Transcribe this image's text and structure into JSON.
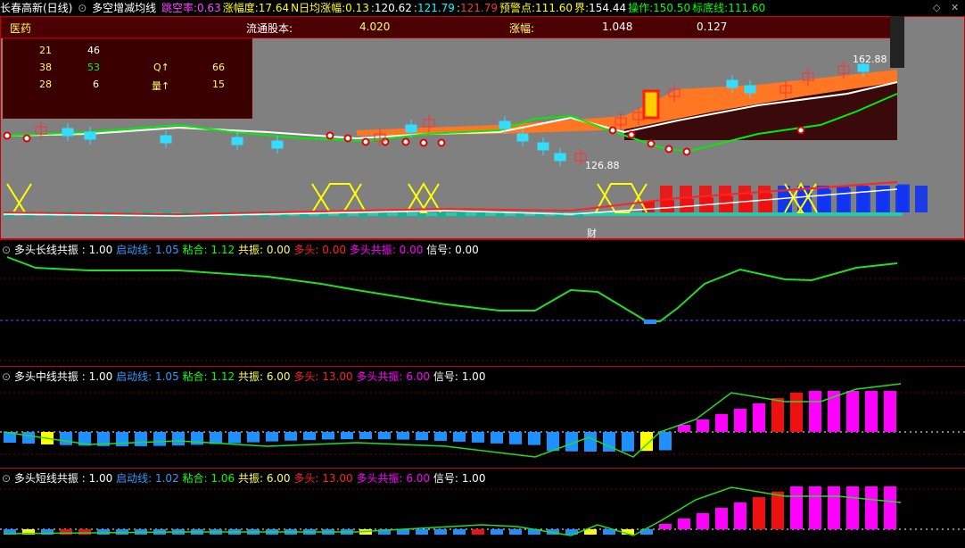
{
  "topbar": {
    "stock": "长春高新(日线)",
    "indicator": "多空增减均线",
    "items": [
      {
        "label": "跳空率:",
        "value": "0.63",
        "color": "#ff44ff"
      },
      {
        "label": "涨幅度:",
        "value": "17.64",
        "color": "#ffff00"
      },
      {
        "label": "N日均涨幅:",
        "value": "0.13",
        "color": "#ffff00"
      },
      {
        "label": ":",
        "value": "120.62",
        "color": "#ffffff"
      },
      {
        "label": ":",
        "value": "121.79",
        "color": "#00ffff"
      },
      {
        "label": ":",
        "value": "121.79",
        "color": "#ff3333"
      },
      {
        "label": "预警点:",
        "value": "111.60",
        "color": "#ffff00"
      },
      {
        "label": "界:",
        "value": "154.44",
        "color": "#ffffff"
      },
      {
        "label": "操作:",
        "value": "150.50",
        "color": "#00ff00"
      },
      {
        "label": "标底线:",
        "value": "111.60",
        "color": "#00ff00"
      }
    ]
  },
  "header": {
    "sector": "医药",
    "float_label": "流通股本:",
    "float_value": "4.020",
    "change_label": "涨幅:",
    "change_value": "1.048",
    "extra_value": "0.127"
  },
  "info": {
    "r1": [
      "21",
      "46"
    ],
    "r2": [
      "38",
      "53",
      "Q↑",
      "66"
    ],
    "r3": [
      "28",
      "6",
      "量↑",
      "15"
    ]
  },
  "price_labels": {
    "high": "162.88",
    "low": "126.88",
    "mid": "财"
  },
  "panels": [
    {
      "title": "多头长线共振",
      "v0": "1.00",
      "l1": "启动线",
      "v1": "1.05",
      "l2": "粘合",
      "v2": "1.12",
      "l3": "共振",
      "v3": "0.00",
      "l4": "多头",
      "v4": "0.00",
      "l5": "多头共振",
      "v5": "0.00",
      "l6": "信号",
      "v6": "0.00"
    },
    {
      "title": "多头中线共振",
      "v0": "1.00",
      "l1": "启动线",
      "v1": "1.05",
      "l2": "粘合",
      "v2": "1.12",
      "l3": "共振",
      "v3": "6.00",
      "l4": "多头",
      "v4": "13.00",
      "l5": "多头共振",
      "v5": "6.00",
      "l6": "信号",
      "v6": "1.00"
    },
    {
      "title": "多头短线共振",
      "v0": "1.00",
      "l1": "启动线",
      "v1": "1.02",
      "l2": "粘合",
      "v2": "1.06",
      "l3": "共振",
      "v3": "6.00",
      "l4": "多头",
      "v4": "13.00",
      "l5": "多头共振",
      "v5": "6.00",
      "l6": "信号",
      "v6": "1.00"
    }
  ],
  "colors": {
    "up": "#ff2222",
    "down": "#33ddff",
    "ma": "#00ff00",
    "magenta": "#ff00ff",
    "blue": "#1e90ff",
    "yellow": "#ffff00"
  }
}
